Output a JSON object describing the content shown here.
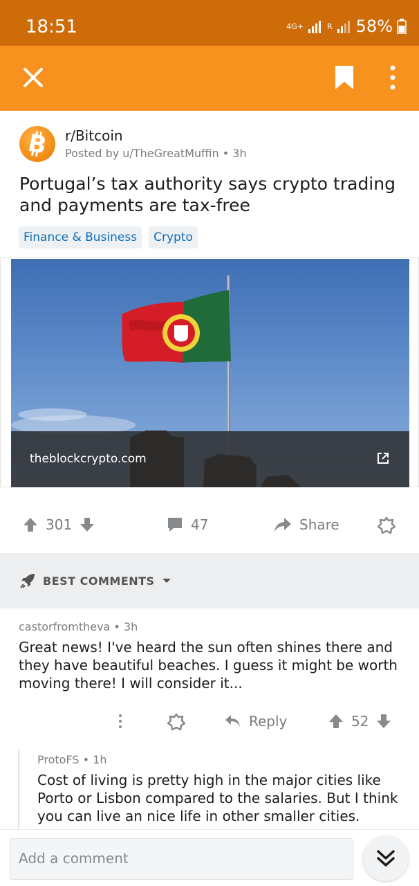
{
  "status": {
    "time": "18:51",
    "network": "4G+",
    "roaming": "R",
    "battery": "58%"
  },
  "post": {
    "subreddit": "r/Bitcoin",
    "posted_by": "Posted by u/TheGreatMuffin • 3h",
    "title": "Portugal’s tax authority says crypto trading and payments are tax-free",
    "flairs": [
      "Finance & Business",
      "Crypto"
    ],
    "link_domain": "theblockcrypto.com",
    "score": "301",
    "comments": "47",
    "share_label": "Share"
  },
  "sort": {
    "label": "BEST COMMENTS"
  },
  "comments": [
    {
      "author_meta": "castorfromtheva • 3h",
      "body": "Great news! I've heard the sun often shines there and they have beautiful beaches. I guess it might be worth moving there! I will consider it...",
      "reply_label": "Reply",
      "score": "52"
    },
    {
      "author_meta": "ProtoFS • 1h",
      "body": "Cost of living is pretty high in the major cities like Porto or Lisbon compared to the salaries. But I think you can live an nice life in other smaller cities."
    }
  ],
  "composer": {
    "placeholder": "Add a comment"
  },
  "colors": {
    "app_bar": "#f7921e",
    "status_bar": "#cf6c0a",
    "flair_text": "#0a6bb5"
  }
}
